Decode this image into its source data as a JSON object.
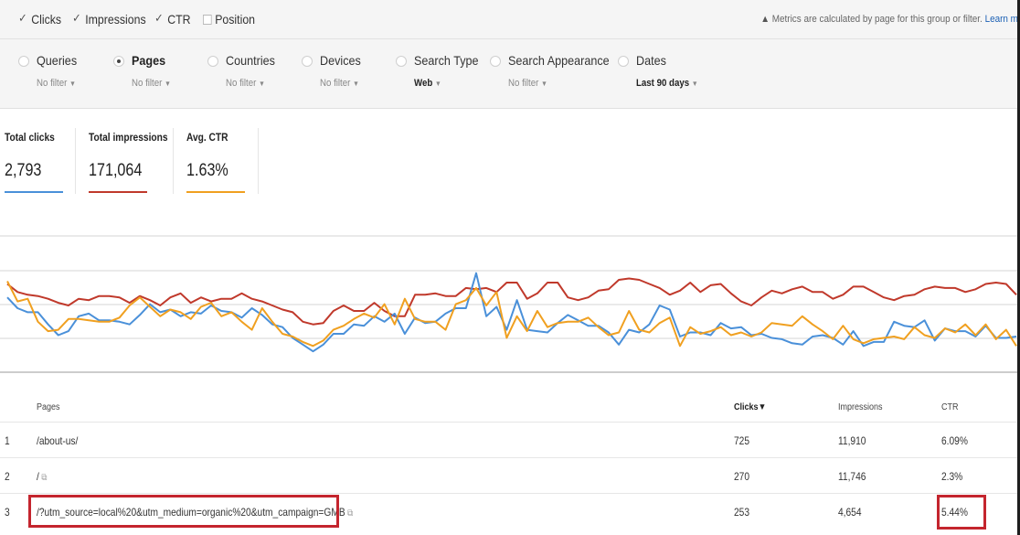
{
  "metrics": {
    "items": [
      {
        "label": "Clicks",
        "checked": true
      },
      {
        "label": "Impressions",
        "checked": true
      },
      {
        "label": "CTR",
        "checked": true
      },
      {
        "label": "Position",
        "checked": false
      }
    ],
    "notice_prefix": "Metrics are calculated by page for this group or filter.",
    "notice_link": "Learn m"
  },
  "filters": [
    {
      "label": "Queries",
      "value": "No filter",
      "selected": false
    },
    {
      "label": "Pages",
      "value": "No filter",
      "selected": true
    },
    {
      "label": "Countries",
      "value": "No filter",
      "selected": false
    },
    {
      "label": "Devices",
      "value": "No filter",
      "selected": false
    },
    {
      "label": "Search Type",
      "value": "Web",
      "selected": false
    },
    {
      "label": "Search Appearance",
      "value": "No filter",
      "selected": false
    },
    {
      "label": "Dates",
      "value": "Last 90 days",
      "selected": false
    }
  ],
  "stats": [
    {
      "label": "Total clicks",
      "value": "2,793",
      "color": "#4a90d9"
    },
    {
      "label": "Total impressions",
      "value": "171,064",
      "color": "#c0392b"
    },
    {
      "label": "Avg. CTR",
      "value": "1.63%",
      "color": "#f0a020"
    }
  ],
  "chart_data": {
    "type": "line",
    "grid": true,
    "series": [
      {
        "color": "#c0392b",
        "values": [
          58,
          52,
          50,
          49,
          47,
          44,
          42,
          47,
          46,
          49,
          49,
          48,
          44,
          49,
          46,
          42,
          48,
          51,
          44,
          48,
          45,
          47,
          47,
          51,
          47,
          45,
          42,
          39,
          37,
          30,
          28,
          29,
          38,
          42,
          38,
          38,
          44,
          38,
          34,
          34,
          50,
          50,
          51,
          49,
          49,
          55,
          54,
          55,
          52,
          59,
          59,
          47,
          51,
          59,
          59,
          48,
          46,
          48,
          53,
          54,
          61,
          62,
          61,
          58,
          55,
          50,
          53,
          59,
          52,
          57,
          58,
          51,
          45,
          42,
          48,
          53,
          51,
          54,
          56,
          52,
          52,
          47,
          50,
          56,
          56,
          52,
          48,
          46,
          49,
          50,
          54,
          56,
          55,
          55,
          52,
          54,
          58,
          59,
          58,
          50
        ]
      },
      {
        "color": "#4a90d9",
        "values": [
          48,
          40,
          37,
          37,
          28,
          20,
          23,
          34,
          36,
          31,
          31,
          30,
          28,
          35,
          43,
          37,
          39,
          34,
          37,
          36,
          42,
          38,
          37,
          33,
          40,
          35,
          28,
          26,
          18,
          13,
          8,
          13,
          21,
          21,
          28,
          27,
          34,
          30,
          36,
          21,
          33,
          29,
          30,
          36,
          40,
          40,
          66,
          34,
          41,
          24,
          46,
          24,
          23,
          22,
          29,
          35,
          31,
          27,
          27,
          22,
          13,
          24,
          22,
          28,
          42,
          39,
          19,
          22,
          22,
          20,
          29,
          25,
          26,
          20,
          21,
          18,
          17,
          14,
          13,
          19,
          20,
          18,
          13,
          23,
          12,
          15,
          15,
          30,
          27,
          26,
          31,
          16,
          25,
          23,
          23,
          19,
          27,
          18,
          18,
          19
        ]
      },
      {
        "color": "#f0a020",
        "values": [
          60,
          45,
          47,
          30,
          23,
          24,
          32,
          32,
          31,
          30,
          30,
          33,
          42,
          48,
          41,
          34,
          39,
          37,
          32,
          41,
          44,
          34,
          37,
          30,
          24,
          40,
          30,
          21,
          19,
          15,
          12,
          16,
          24,
          27,
          32,
          36,
          33,
          43,
          28,
          47,
          32,
          30,
          30,
          24,
          43,
          46,
          55,
          42,
          52,
          18,
          34,
          23,
          38,
          26,
          29,
          30,
          30,
          33,
          26,
          20,
          22,
          38,
          24,
          22,
          29,
          33,
          12,
          26,
          21,
          23,
          26,
          20,
          22,
          19,
          22,
          29,
          28,
          27,
          34,
          28,
          23,
          17,
          27,
          17,
          14,
          17,
          18,
          19,
          17,
          26,
          20,
          18,
          25,
          22,
          28,
          20,
          28,
          17,
          24,
          12
        ]
      }
    ]
  },
  "table": {
    "columns": [
      "Pages",
      "Clicks▼",
      "Impressions",
      "CTR"
    ],
    "rows": [
      {
        "num": "1",
        "page": "/about-us/",
        "clicks": "725",
        "impressions": "11,910",
        "ctr": "6.09%",
        "ext": false
      },
      {
        "num": "2",
        "page": "/",
        "clicks": "270",
        "impressions": "11,746",
        "ctr": "2.3%",
        "ext": true
      },
      {
        "num": "3",
        "page": "/?utm_source=local%20&utm_medium=organic%20&utm_campaign=GMB",
        "clicks": "253",
        "impressions": "4,654",
        "ctr": "5.44%",
        "ext": true
      }
    ]
  },
  "highlight_color": "#c4252e"
}
